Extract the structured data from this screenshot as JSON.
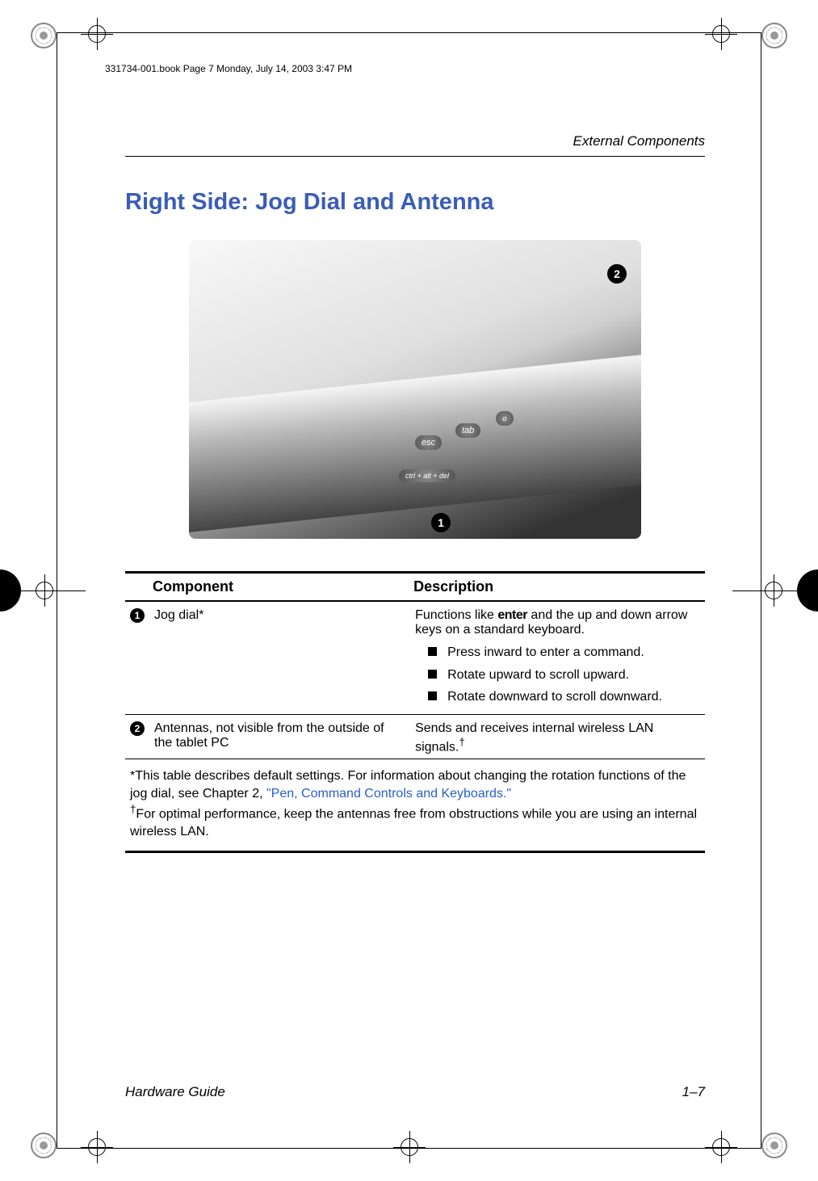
{
  "book_header": "331734-001.book  Page 7  Monday, July 14, 2003  3:47 PM",
  "running_head": "External Components",
  "section_title": "Right Side: Jog Dial and Antenna",
  "figure": {
    "btn_esc": "esc",
    "btn_tab": "tab",
    "btn_q": "a",
    "btn_ctrl": "ctrl + alt + del",
    "callout_1": "1",
    "callout_2": "2"
  },
  "table": {
    "headers": {
      "component": "Component",
      "description": "Description"
    },
    "rows": [
      {
        "num": "1",
        "component": "Jog dial*",
        "desc_intro_pre": "Functions like ",
        "desc_intro_bold": "enter",
        "desc_intro_post": " and the up and down arrow keys on a standard keyboard.",
        "bullets": [
          "Press inward to enter a command.",
          "Rotate upward to scroll upward.",
          "Rotate downward to scroll downward."
        ]
      },
      {
        "num": "2",
        "component": "Antennas, not visible from the outside of the tablet PC",
        "desc": "Sends and receives internal wireless LAN signals.",
        "dagger": "†"
      }
    ],
    "footnote1_pre": "*This table describes default settings. For information about changing the rotation functions of the jog dial, see Chapter 2, ",
    "footnote1_link": "\"Pen, Command Controls and Keyboards.\"",
    "footnote2_dagger": "†",
    "footnote2": "For optimal performance, keep the antennas free from obstructions while you are using an internal wireless LAN."
  },
  "footer": {
    "left": "Hardware Guide",
    "right": "1–7"
  }
}
